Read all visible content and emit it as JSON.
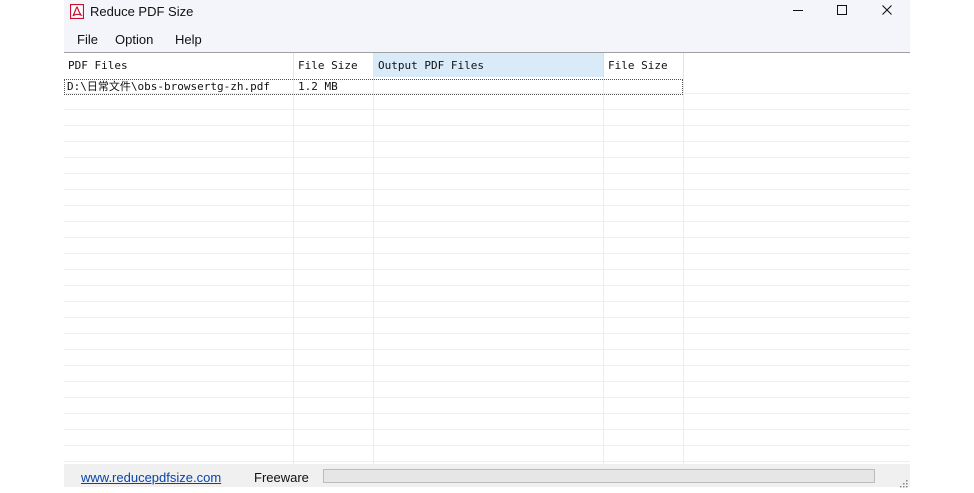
{
  "window": {
    "title": "Reduce PDF Size",
    "controls": {
      "minimize": "minimize-icon",
      "maximize": "maximize-icon",
      "close": "close-icon"
    }
  },
  "menu": {
    "items": [
      {
        "label": "File"
      },
      {
        "label": "Option"
      },
      {
        "label": "Help"
      }
    ]
  },
  "list": {
    "columns": [
      {
        "label": "PDF Files"
      },
      {
        "label": "File Size"
      },
      {
        "label": "Output PDF Files",
        "selected": true
      },
      {
        "label": "File Size"
      }
    ],
    "rows": [
      {
        "pdf_file": "D:\\日常文件\\obs-browsertg-zh.pdf",
        "file_size": "1.2 MB",
        "output_file": "",
        "output_size": ""
      }
    ]
  },
  "status": {
    "link": "www.reducepdfsize.com",
    "license": "Freeware",
    "progress_fraction": 0
  },
  "colors": {
    "titlebar_bg": "#f3f5fa",
    "selected_header_bg": "#d9ebf9",
    "link": "#0645ad",
    "app_icon_red": "#c8102e"
  }
}
